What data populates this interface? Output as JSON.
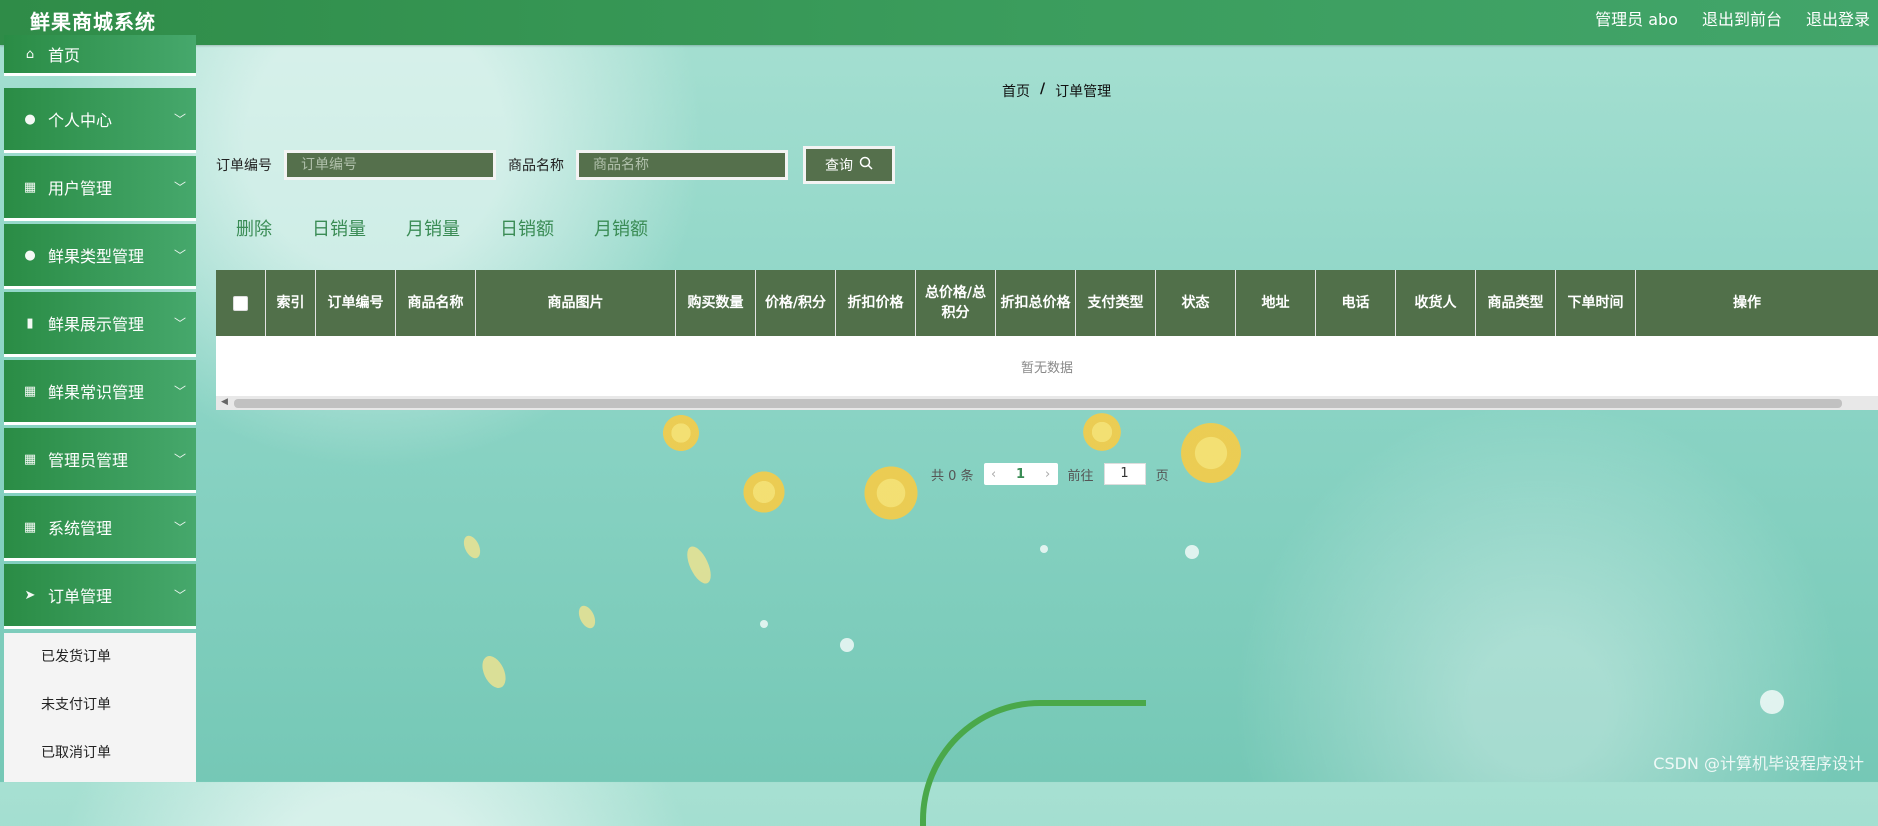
{
  "app": {
    "title": "鲜果商城系统"
  },
  "topnav": [
    {
      "label": "管理员 abo"
    },
    {
      "label": "退出到前台"
    },
    {
      "label": "退出登录"
    }
  ],
  "sidebar": {
    "items": [
      {
        "label": "首页",
        "icon": "home-icon"
      },
      {
        "label": "个人中心",
        "icon": "user-icon"
      },
      {
        "label": "用户管理",
        "icon": "grid-icon"
      },
      {
        "label": "鲜果类型管理",
        "icon": "user-icon"
      },
      {
        "label": "鲜果展示管理",
        "icon": "bar-chart-icon"
      },
      {
        "label": "鲜果常识管理",
        "icon": "grid-icon"
      },
      {
        "label": "管理员管理",
        "icon": "grid-icon"
      },
      {
        "label": "系统管理",
        "icon": "grid-icon"
      },
      {
        "label": "订单管理",
        "icon": "send-icon"
      }
    ],
    "submenu": [
      {
        "label": "已发货订单"
      },
      {
        "label": "未支付订单"
      },
      {
        "label": "已取消订单"
      }
    ]
  },
  "breadcrumb": {
    "home": "首页",
    "separator": "/",
    "current": "订单管理"
  },
  "search": {
    "order_label": "订单编号",
    "order_placeholder": "订单编号",
    "product_label": "商品名称",
    "product_placeholder": "商品名称",
    "query_label": "查询"
  },
  "actions": [
    "删除",
    "日销量",
    "月销量",
    "日销额",
    "月销额"
  ],
  "table": {
    "headers": [
      "",
      "索引",
      "订单编号",
      "商品名称",
      "商品图片",
      "购买数量",
      "价格/积分",
      "折扣价格",
      "总价格/总积分",
      "折扣总价格",
      "支付类型",
      "状态",
      "地址",
      "电话",
      "收货人",
      "商品类型",
      "下单时间",
      "操作"
    ],
    "empty_text": "暂无数据"
  },
  "pagination": {
    "total_text": "共 0 条",
    "current_page": "1",
    "goto_label": "前往",
    "goto_value": "1",
    "page_suffix": "页"
  },
  "watermark": "CSDN @计算机毕设程序设计",
  "colors": {
    "primary_green": "#2f8c48",
    "header_dark": "#51704a",
    "accent_text": "#3a8c55"
  }
}
